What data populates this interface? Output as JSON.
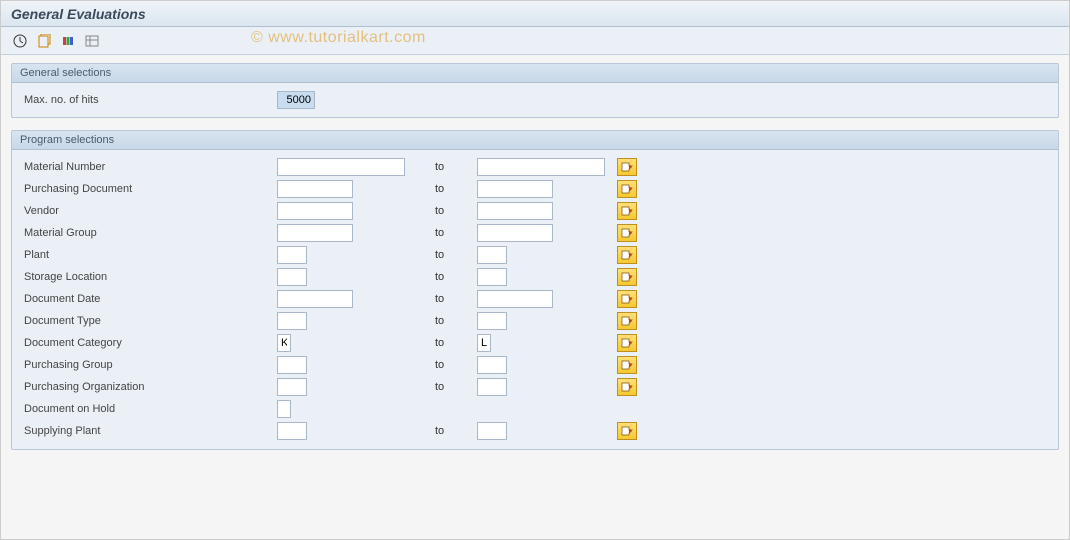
{
  "title": "General Evaluations",
  "watermark": "© www.tutorialkart.com",
  "panels": {
    "general": {
      "title": "General selections",
      "max_hits_label": "Max. no. of hits",
      "max_hits_value": "5000"
    },
    "program": {
      "title": "Program selections",
      "to_label": "to",
      "rows": {
        "material": {
          "label": "Material Number",
          "from": "",
          "to": ""
        },
        "purchdoc": {
          "label": "Purchasing Document",
          "from": "",
          "to": ""
        },
        "vendor": {
          "label": "Vendor",
          "from": "",
          "to": ""
        },
        "matgroup": {
          "label": "Material Group",
          "from": "",
          "to": ""
        },
        "plant": {
          "label": "Plant",
          "from": "",
          "to": ""
        },
        "storageloc": {
          "label": "Storage Location",
          "from": "",
          "to": ""
        },
        "docdate": {
          "label": "Document Date",
          "from": "",
          "to": ""
        },
        "doctype": {
          "label": "Document Type",
          "from": "",
          "to": ""
        },
        "doccat": {
          "label": "Document Category",
          "from": "K",
          "to": "L"
        },
        "purchgroup": {
          "label": "Purchasing Group",
          "from": "",
          "to": ""
        },
        "purchorg": {
          "label": "Purchasing Organization",
          "from": "",
          "to": ""
        },
        "dochold": {
          "label": "Document on Hold",
          "from": ""
        },
        "supplant": {
          "label": "Supplying Plant",
          "from": "",
          "to": ""
        }
      }
    }
  }
}
